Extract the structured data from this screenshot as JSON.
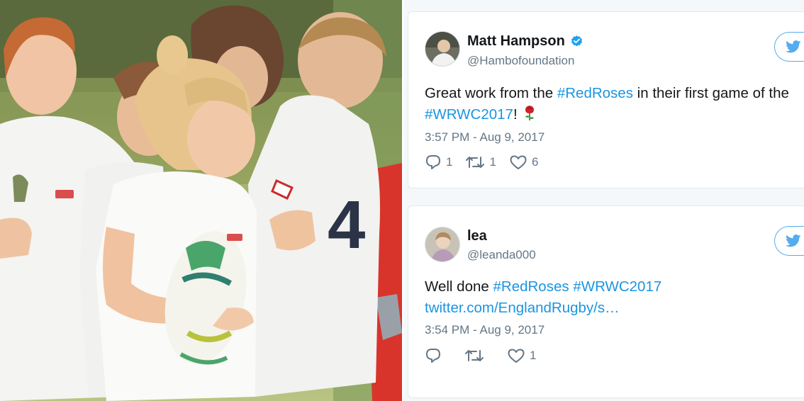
{
  "tweets": [
    {
      "name": "Matt Hampson",
      "verified": true,
      "handle": "@Hambofoundation",
      "text_line1_prefix": "Great work from the ",
      "text_line1_hashtag": "#RedRoses",
      "text_line1_suffix": " in their first game of the",
      "text_line2_hashtag": "#WRWC2017",
      "text_line2_suffix": "!",
      "emoji": "rose-emoji",
      "timestamp": "3:57 PM - Aug 9, 2017",
      "replies": "1",
      "retweets": "1",
      "likes": "6"
    },
    {
      "name": "lea",
      "verified": false,
      "handle": "@leanda000",
      "text_line1_prefix": "Well done ",
      "text_line1_hashtag1": "#RedRoses",
      "text_line1_hashtag2": "#WRWC2017",
      "text_line2_link": "twitter.com/EnglandRugby/s…",
      "timestamp": "3:54 PM - Aug 9, 2017",
      "replies": "",
      "retweets": "",
      "likes": "1"
    }
  ],
  "photo": {
    "shirt_number": "4"
  },
  "colors": {
    "link": "#1b95e0",
    "muted": "#657786",
    "twitter_blue": "#55acee",
    "verified": "#1da1f2"
  },
  "icons": [
    "verified-badge-icon",
    "twitter-bird-icon",
    "reply-icon",
    "retweet-icon",
    "like-icon",
    "rose-emoji"
  ]
}
